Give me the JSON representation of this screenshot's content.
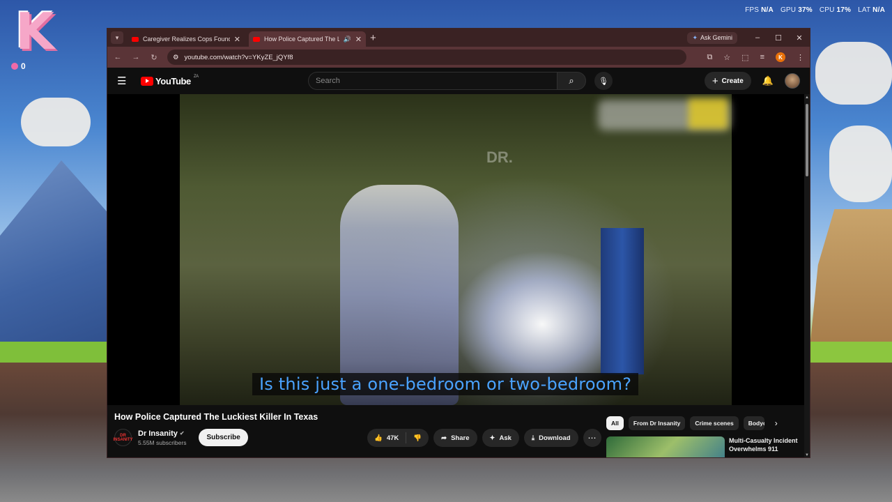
{
  "desktop": {
    "widget_letter": "K",
    "widget_stat": "0",
    "perf": {
      "fps_label": "FPS",
      "fps_value": "N/A",
      "gpu_label": "GPU",
      "gpu_value": "37%",
      "cpu_label": "CPU",
      "cpu_value": "17%",
      "lat_label": "LAT",
      "lat_value": "N/A"
    }
  },
  "browser": {
    "tabs": [
      {
        "title": "Caregiver Realizes Cops Found",
        "active": false
      },
      {
        "title": "How Police Captured The L",
        "active": true
      }
    ],
    "new_tab": "+",
    "gemini_label": "Ask Gemini",
    "url": "youtube.com/watch?v=YKyZE_jQYf8",
    "profile_initial": "K",
    "window_controls": {
      "minimize": "–",
      "maximize": "☐",
      "close": "✕"
    }
  },
  "youtube": {
    "logo_text": "YouTube",
    "region": "ZA",
    "search_placeholder": "Search",
    "create_label": "Create",
    "caption": "Is this just a one-bedroom or two-bedroom?",
    "watermark": "DR.",
    "video_title": "How Police Captured The Luckiest Killer In Texas",
    "channel": {
      "name": "Dr Insanity",
      "subscribers": "5.55M subscribers",
      "avatar_text": "DR INSANITY"
    },
    "subscribe_label": "Subscribe",
    "actions": {
      "likes": "47K",
      "share": "Share",
      "ask": "Ask",
      "download": "Download"
    },
    "chips": [
      "All",
      "From Dr Insanity",
      "Crime scenes",
      "Bodyc"
    ],
    "recommendation": {
      "title": "Multi-Casualty Incident Overwhelms 911"
    }
  }
}
